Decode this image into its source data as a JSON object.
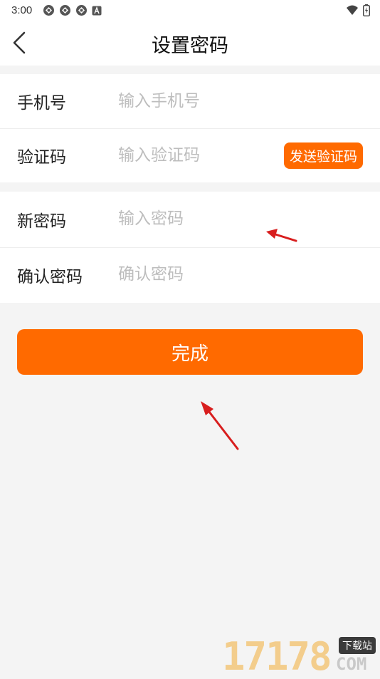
{
  "status_bar": {
    "time": "3:00",
    "left_icons": [
      "sync-icon",
      "sync-icon",
      "sync-icon",
      "a-icon"
    ],
    "right_icons": [
      "wifi-icon",
      "battery-icon"
    ]
  },
  "header": {
    "title": "设置密码",
    "back_icon": "chevron-left-icon"
  },
  "form": {
    "phone": {
      "label": "手机号",
      "placeholder": "输入手机号"
    },
    "code": {
      "label": "验证码",
      "placeholder": "输入验证码",
      "send_label": "发送验证码"
    },
    "new_password": {
      "label": "新密码",
      "placeholder": "输入密码"
    },
    "confirm_password": {
      "label": "确认密码",
      "placeholder": "确认密码"
    }
  },
  "submit_label": "完成",
  "watermark": {
    "digits": "17178",
    "badge": "下载站",
    "suffix": "COM"
  },
  "colors": {
    "accent": "#ff6a00",
    "background": "#f4f4f4",
    "placeholder": "#bdbdbd",
    "arrow": "#d81e1e"
  }
}
